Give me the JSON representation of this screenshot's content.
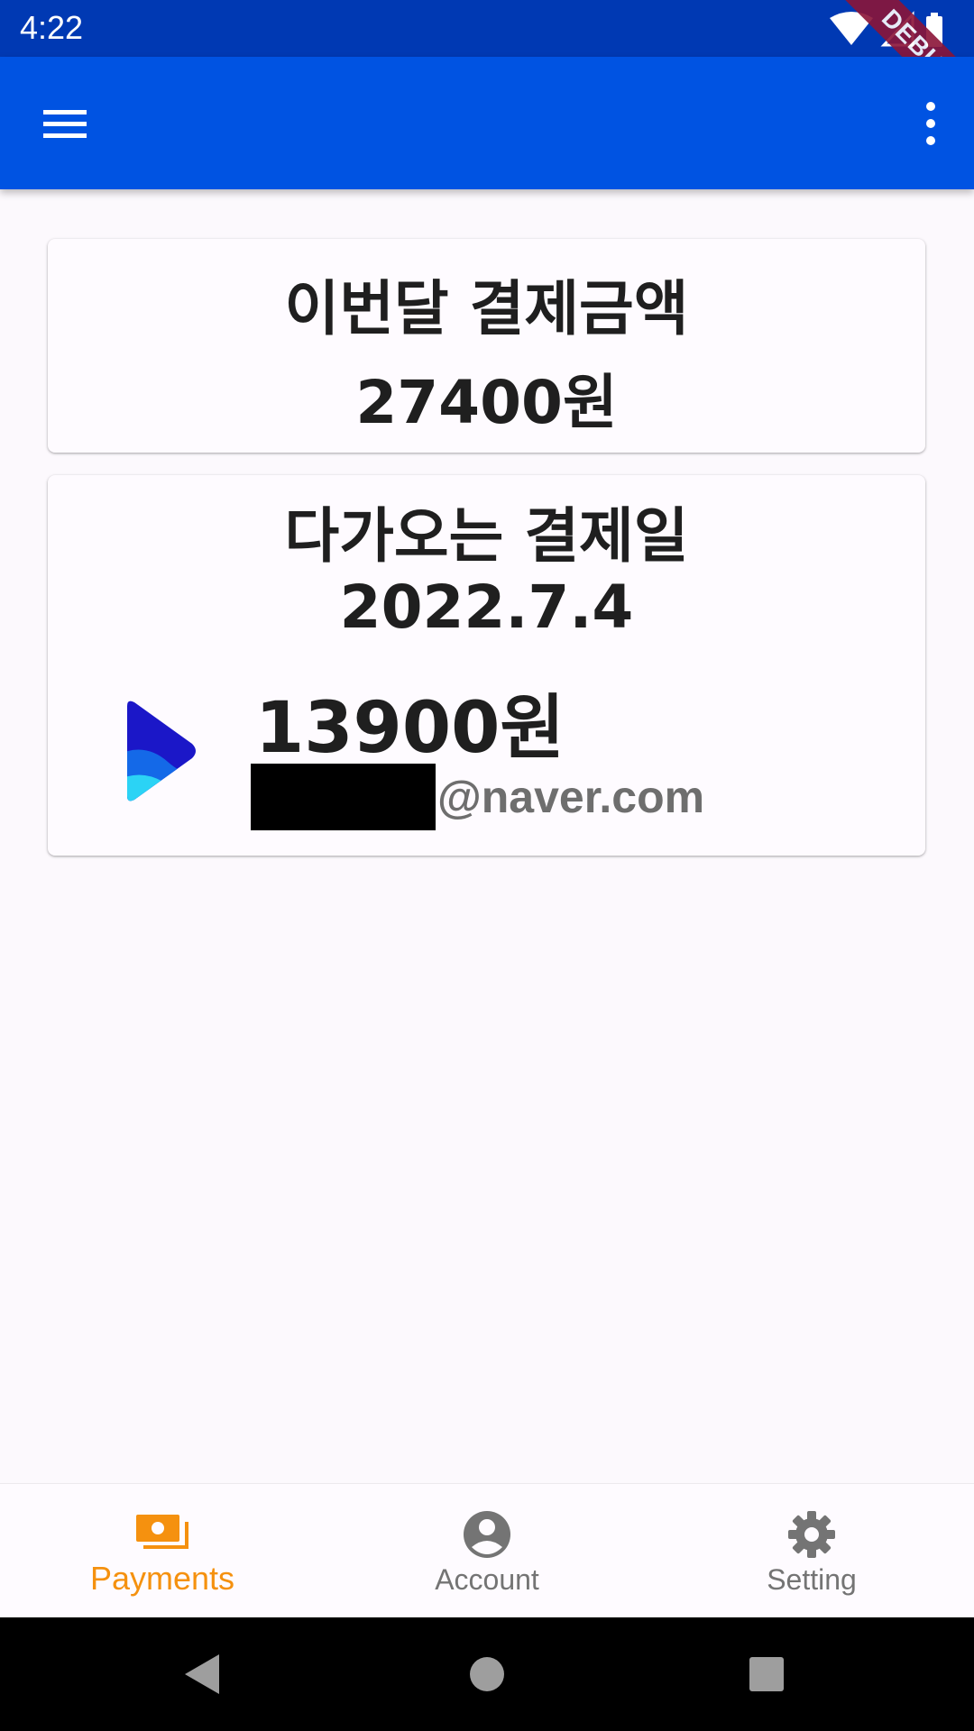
{
  "status_bar": {
    "time": "4:22",
    "debug_label": "DEBUG",
    "icons": [
      "wifi-icon",
      "cellular-signal-icon",
      "battery-icon"
    ]
  },
  "app_bar": {
    "color": "#0053e2",
    "icons": [
      "menu-icon",
      "more-vert-icon"
    ]
  },
  "summary_card": {
    "title": "이번달 결제금액",
    "amount": "27400원"
  },
  "upcoming_card": {
    "title": "다가오는 결제일",
    "date": "2022.7.4",
    "subscription": {
      "logo": "play-logo-icon",
      "amount": "13900원",
      "account_domain": "@naver.com"
    }
  },
  "bottom_nav": {
    "active_color": "#f5910f",
    "items": [
      {
        "label": "Payments",
        "icon": "payments-icon",
        "active": true
      },
      {
        "label": "Account",
        "icon": "account-circle-icon",
        "active": false
      },
      {
        "label": "Setting",
        "icon": "settings-gear-icon",
        "active": false
      }
    ]
  },
  "system_nav": {
    "icons": [
      "back-icon",
      "home-icon",
      "recents-icon"
    ]
  }
}
